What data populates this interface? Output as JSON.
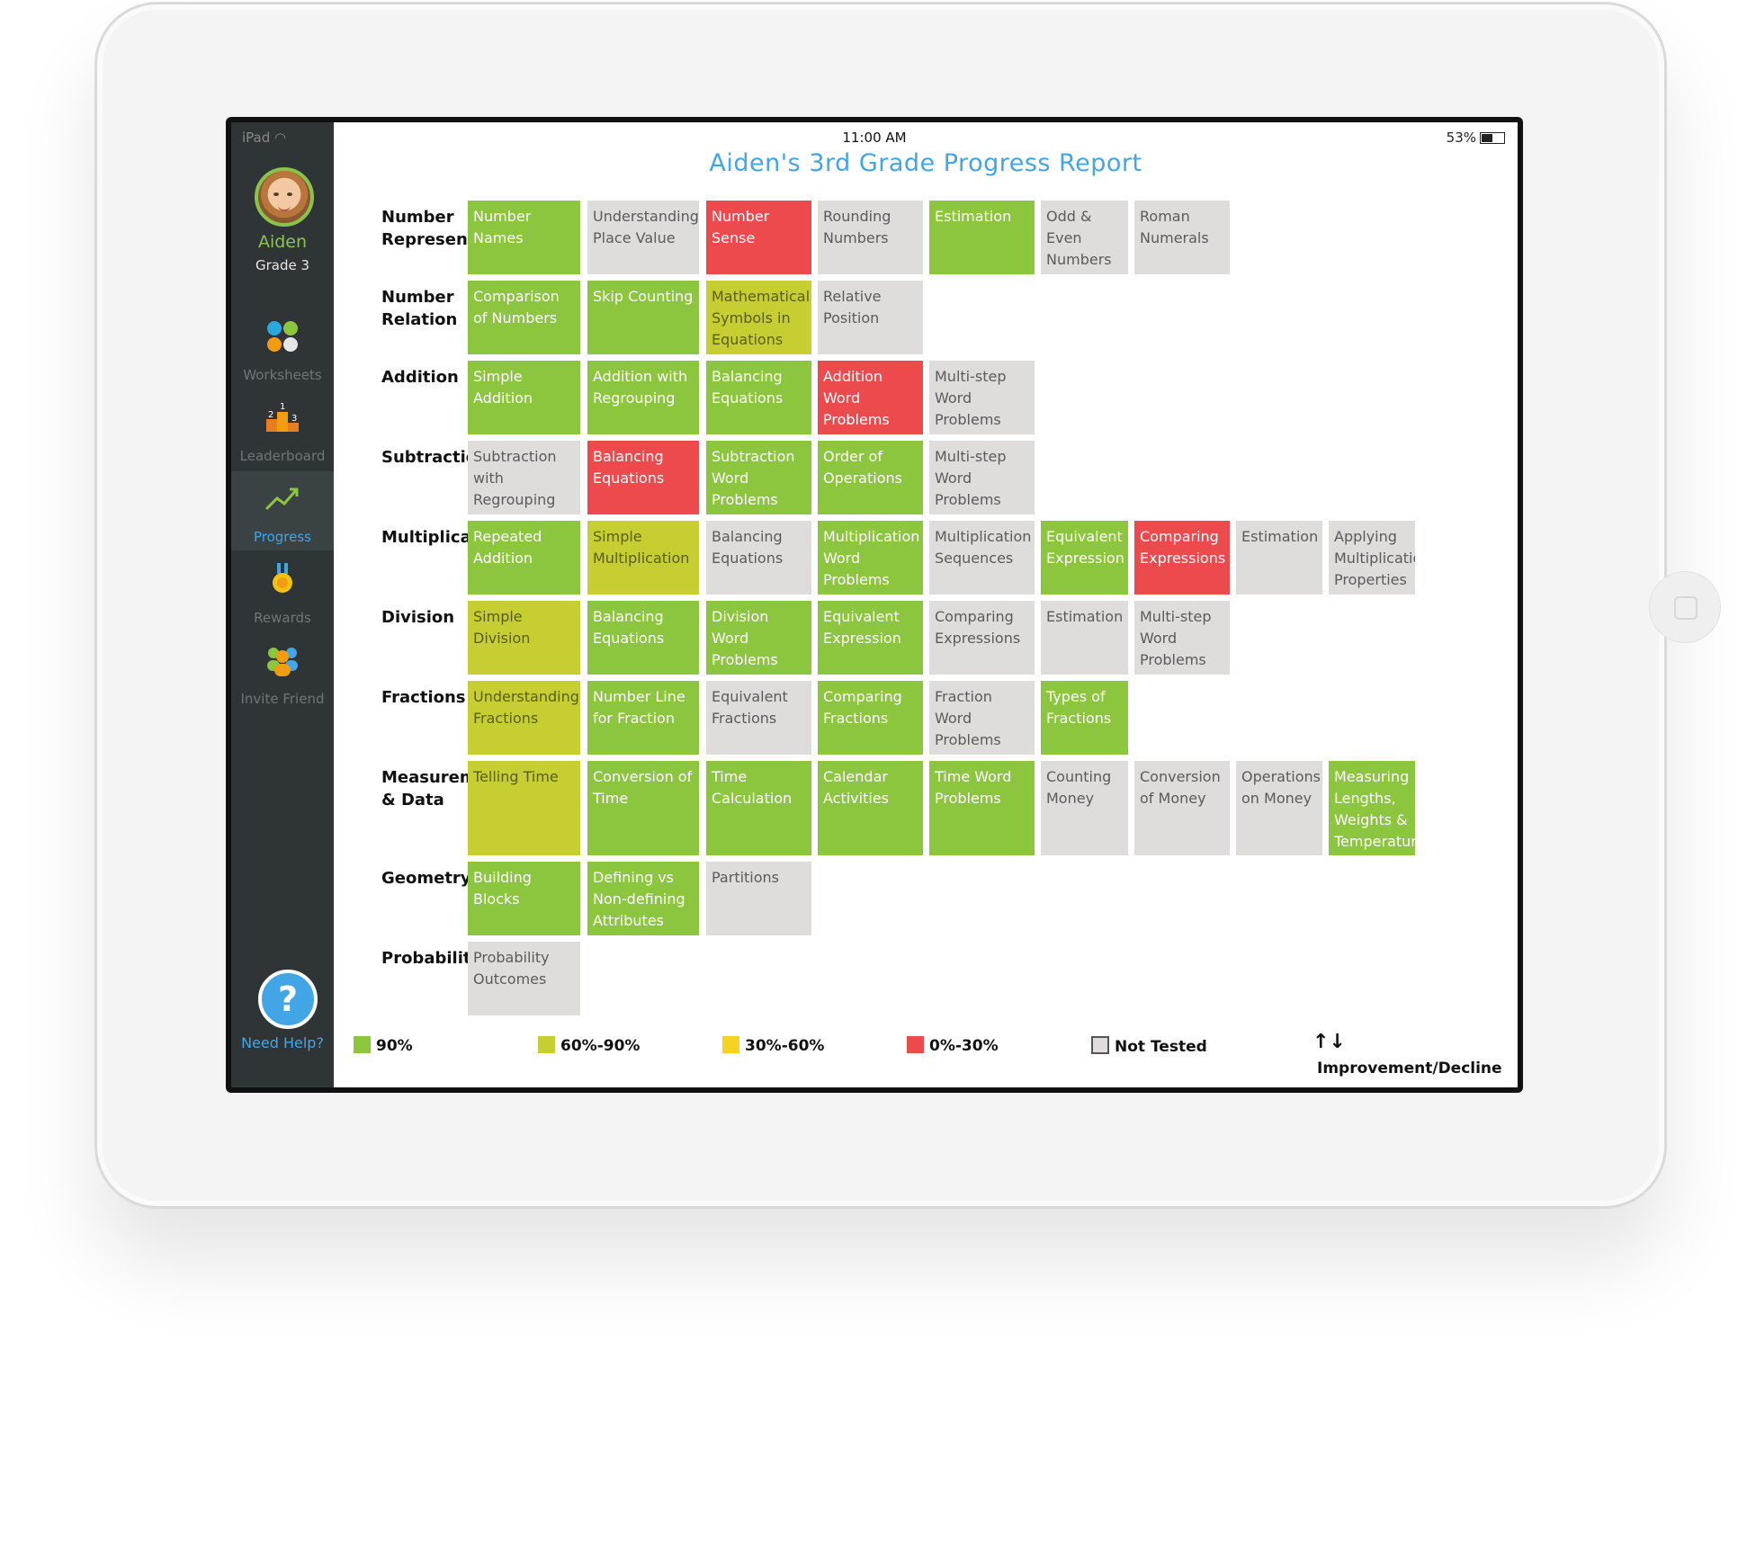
{
  "status": {
    "carrier": "iPad",
    "time": "11:00 AM",
    "battery": "53%"
  },
  "user": {
    "name": "Aiden",
    "grade": "Grade 3"
  },
  "nav": [
    {
      "label": "Worksheets"
    },
    {
      "label": "Leaderboard"
    },
    {
      "label": "Progress"
    },
    {
      "label": "Rewards"
    },
    {
      "label": "Invite Friend"
    }
  ],
  "help": {
    "symbol": "?",
    "label": "Need Help?"
  },
  "title": "Aiden's 3rd Grade Progress Report",
  "colors": {
    "green": "#8cc63f",
    "yellow_green": "#c6ce31",
    "yellow": "#f5d320",
    "red": "#ec4a4d",
    "grey": "#dedddb",
    "accent": "#42a5e6"
  },
  "rows": [
    {
      "label": "Number Representation",
      "cells": [
        {
          "text": "Number Names",
          "status": "g"
        },
        {
          "text": "Understanding Place Value",
          "status": "n"
        },
        {
          "text": "Number Sense",
          "status": "r"
        },
        {
          "text": "Rounding Numbers",
          "status": "n"
        },
        {
          "text": "Estimation",
          "status": "g"
        },
        {
          "text": "Odd & Even Numbers",
          "status": "n"
        },
        {
          "text": "Roman Numerals",
          "status": "n"
        }
      ]
    },
    {
      "label": "Number Relation",
      "cells": [
        {
          "text": "Comparison of Numbers",
          "status": "g"
        },
        {
          "text": "Skip Counting",
          "status": "g"
        },
        {
          "text": "Mathematical Symbols in Equations",
          "status": "y"
        },
        {
          "text": "Relative Position",
          "status": "n"
        }
      ]
    },
    {
      "label": "Addition",
      "cells": [
        {
          "text": "Simple Addition",
          "status": "g"
        },
        {
          "text": "Addition with Regrouping",
          "status": "g"
        },
        {
          "text": "Balancing Equations",
          "status": "g"
        },
        {
          "text": "Addition Word Problems",
          "status": "r"
        },
        {
          "text": "Multi-step Word Problems",
          "status": "n"
        }
      ]
    },
    {
      "label": "Subtraction",
      "cells": [
        {
          "text": "Subtraction with Regrouping",
          "status": "n"
        },
        {
          "text": "Balancing Equations",
          "status": "r"
        },
        {
          "text": "Subtraction Word Problems",
          "status": "g"
        },
        {
          "text": "Order of Operations",
          "status": "g"
        },
        {
          "text": "Multi-step Word Problems",
          "status": "n"
        }
      ]
    },
    {
      "label": "Multiplication",
      "cells": [
        {
          "text": "Repeated Addition",
          "status": "g"
        },
        {
          "text": "Simple Multiplication",
          "status": "y"
        },
        {
          "text": "Balancing Equations",
          "status": "n"
        },
        {
          "text": "Multiplication Word Problems",
          "status": "g"
        },
        {
          "text": "Multiplication Sequences",
          "status": "n"
        },
        {
          "text": "Equivalent Expression",
          "status": "g"
        },
        {
          "text": "Comparing Expressions",
          "status": "r"
        },
        {
          "text": "Estimation",
          "status": "n"
        },
        {
          "text": "Applying Multiplication Properties",
          "status": "n"
        }
      ]
    },
    {
      "label": "Division",
      "cells": [
        {
          "text": "Simple Division",
          "status": "y"
        },
        {
          "text": "Balancing Equations",
          "status": "g"
        },
        {
          "text": "Division Word Problems",
          "status": "g"
        },
        {
          "text": "Equivalent Expression",
          "status": "g"
        },
        {
          "text": "Comparing Expressions",
          "status": "n"
        },
        {
          "text": "Estimation",
          "status": "n"
        },
        {
          "text": "Multi-step Word Problems",
          "status": "n"
        }
      ]
    },
    {
      "label": "Fractions",
      "cells": [
        {
          "text": "Understanding Fractions",
          "status": "y"
        },
        {
          "text": "Number Line for Fraction",
          "status": "g"
        },
        {
          "text": "Equivalent Fractions",
          "status": "n"
        },
        {
          "text": "Comparing Fractions",
          "status": "g"
        },
        {
          "text": "Fraction Word Problems",
          "status": "n"
        },
        {
          "text": "Types of Fractions",
          "status": "g"
        }
      ]
    },
    {
      "label": "Measurement & Data",
      "cells": [
        {
          "text": "Telling Time",
          "status": "y"
        },
        {
          "text": "Conversion of Time",
          "status": "g"
        },
        {
          "text": "Time Calculation",
          "status": "g"
        },
        {
          "text": "Calendar Activities",
          "status": "g"
        },
        {
          "text": "Time Word Problems",
          "status": "g"
        },
        {
          "text": "Counting Money",
          "status": "n"
        },
        {
          "text": "Conversion of Money",
          "status": "n"
        },
        {
          "text": "Operations on Money",
          "status": "n"
        },
        {
          "text": "Measuring Lengths, Weights & Temperature",
          "status": "g"
        }
      ]
    },
    {
      "label": "Geometry",
      "cells": [
        {
          "text": "Building Blocks",
          "status": "g"
        },
        {
          "text": "Defining vs Non-defining Attributes",
          "status": "g"
        },
        {
          "text": "Partitions",
          "status": "n"
        }
      ]
    },
    {
      "label": "Probability",
      "cells": [
        {
          "text": "Probability Outcomes",
          "status": "n"
        }
      ]
    }
  ],
  "legend": [
    {
      "label": "90%",
      "status": "g"
    },
    {
      "label": "60%-90%",
      "status": "y"
    },
    {
      "label": "30%-60%",
      "status": "o"
    },
    {
      "label": "0%-30%",
      "status": "r"
    },
    {
      "label": "Not Tested",
      "status": "n"
    }
  ],
  "legend_arrows": "↑↓",
  "legend_improvement": "Improvement/Decline"
}
